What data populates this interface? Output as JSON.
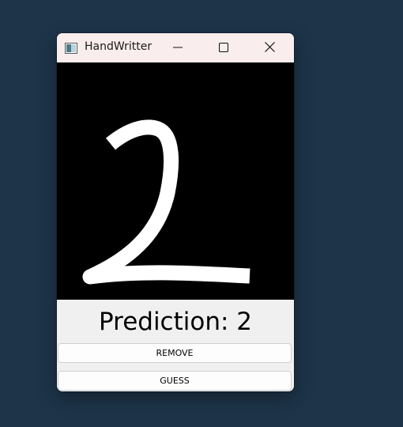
{
  "window": {
    "title": "HandWritter",
    "icons": {
      "app": "app-window-icon",
      "minimize": "minimize-icon",
      "maximize": "maximize-icon",
      "close": "close-icon"
    }
  },
  "canvas": {
    "background": "#000000",
    "stroke_color": "#ffffff"
  },
  "prediction": {
    "text": "Prediction: 2"
  },
  "buttons": {
    "remove_label": "REMOVE",
    "guess_label": "GUESS"
  },
  "colors": {
    "desktop": "#1d3449",
    "titlebar": "#f9eded",
    "window_body": "#f0f0f0"
  }
}
